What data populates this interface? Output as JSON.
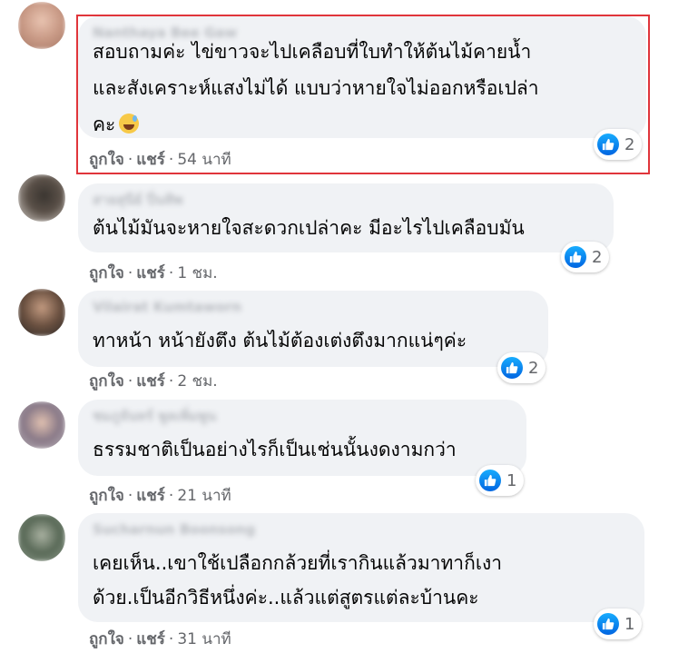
{
  "comments": [
    {
      "name": "Nanthaya Bee Gaw",
      "lines": [
        "สอบถามค่ะ ไข่ขาวจะไปเคลือบที่ใบทำให้ต้นไม้คายน้ำ",
        "และสังเคราะห์แสงไม่ได้ แบบว่าหายใจไม่ออกหรือเปล่า",
        "คะ"
      ],
      "emoji": "grinning-sweat-emoji",
      "like_label": "ถูกใจ",
      "share_label": "แชร์",
      "time": "54 นาที",
      "reactions": "2"
    },
    {
      "name": "สายสุนีย์ ปิ่นทิพ",
      "lines": [
        "ต้นไม้มันจะหายใจสะดวกเปล่าคะ มีอะไรไปเคลือบมัน"
      ],
      "like_label": "ถูกใจ",
      "share_label": "แชร์",
      "time": "1 ชม.",
      "reactions": "2"
    },
    {
      "name": "Vilairat Kumtaworn",
      "lines": [
        "ทาหน้า หน้ายังตึง ต้นไม้ต้องเต่งตึงมากแน่ๆค่ะ"
      ],
      "like_label": "ถูกใจ",
      "share_label": "แชร์",
      "time": "2 ชม.",
      "reactions": "2"
    },
    {
      "name": "ชมภูจันทร์ พูลเพิ่มพูน",
      "lines": [
        "ธรรมชาติเป็นอย่างไรก็เป็นเช่นนั้นงดงามกว่า"
      ],
      "like_label": "ถูกใจ",
      "share_label": "แชร์",
      "time": "21 นาที",
      "reactions": "1"
    },
    {
      "name": "Sucharnun Boonsong",
      "lines": [
        "เคยเห็น..เขาใช้เปลือกกล้วยที่เรากินแล้วมาทาก็เงา",
        "ด้วย.เป็นอีกวิธีหนึ่งค่ะ..แล้วแต่สูตรแต่ละบ้านคะ"
      ],
      "like_label": "ถูกใจ",
      "share_label": "แชร์",
      "time": "31 นาที",
      "reactions": "1"
    }
  ],
  "colors": {
    "bubble": "#f0f2f5",
    "highlight": "#e0353b",
    "like_blue": "#1877f2",
    "meta_gray": "#65676b"
  }
}
